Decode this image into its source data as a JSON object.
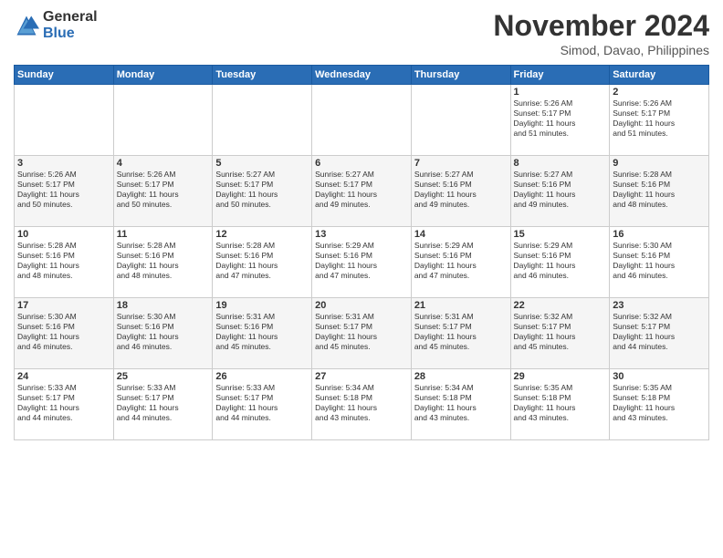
{
  "logo": {
    "general": "General",
    "blue": "Blue"
  },
  "title": "November 2024",
  "location": "Simod, Davao, Philippines",
  "weekdays": [
    "Sunday",
    "Monday",
    "Tuesday",
    "Wednesday",
    "Thursday",
    "Friday",
    "Saturday"
  ],
  "weeks": [
    [
      {
        "day": "",
        "info": ""
      },
      {
        "day": "",
        "info": ""
      },
      {
        "day": "",
        "info": ""
      },
      {
        "day": "",
        "info": ""
      },
      {
        "day": "",
        "info": ""
      },
      {
        "day": "1",
        "info": "Sunrise: 5:26 AM\nSunset: 5:17 PM\nDaylight: 11 hours\nand 51 minutes."
      },
      {
        "day": "2",
        "info": "Sunrise: 5:26 AM\nSunset: 5:17 PM\nDaylight: 11 hours\nand 51 minutes."
      }
    ],
    [
      {
        "day": "3",
        "info": "Sunrise: 5:26 AM\nSunset: 5:17 PM\nDaylight: 11 hours\nand 50 minutes."
      },
      {
        "day": "4",
        "info": "Sunrise: 5:26 AM\nSunset: 5:17 PM\nDaylight: 11 hours\nand 50 minutes."
      },
      {
        "day": "5",
        "info": "Sunrise: 5:27 AM\nSunset: 5:17 PM\nDaylight: 11 hours\nand 50 minutes."
      },
      {
        "day": "6",
        "info": "Sunrise: 5:27 AM\nSunset: 5:17 PM\nDaylight: 11 hours\nand 49 minutes."
      },
      {
        "day": "7",
        "info": "Sunrise: 5:27 AM\nSunset: 5:16 PM\nDaylight: 11 hours\nand 49 minutes."
      },
      {
        "day": "8",
        "info": "Sunrise: 5:27 AM\nSunset: 5:16 PM\nDaylight: 11 hours\nand 49 minutes."
      },
      {
        "day": "9",
        "info": "Sunrise: 5:28 AM\nSunset: 5:16 PM\nDaylight: 11 hours\nand 48 minutes."
      }
    ],
    [
      {
        "day": "10",
        "info": "Sunrise: 5:28 AM\nSunset: 5:16 PM\nDaylight: 11 hours\nand 48 minutes."
      },
      {
        "day": "11",
        "info": "Sunrise: 5:28 AM\nSunset: 5:16 PM\nDaylight: 11 hours\nand 48 minutes."
      },
      {
        "day": "12",
        "info": "Sunrise: 5:28 AM\nSunset: 5:16 PM\nDaylight: 11 hours\nand 47 minutes."
      },
      {
        "day": "13",
        "info": "Sunrise: 5:29 AM\nSunset: 5:16 PM\nDaylight: 11 hours\nand 47 minutes."
      },
      {
        "day": "14",
        "info": "Sunrise: 5:29 AM\nSunset: 5:16 PM\nDaylight: 11 hours\nand 47 minutes."
      },
      {
        "day": "15",
        "info": "Sunrise: 5:29 AM\nSunset: 5:16 PM\nDaylight: 11 hours\nand 46 minutes."
      },
      {
        "day": "16",
        "info": "Sunrise: 5:30 AM\nSunset: 5:16 PM\nDaylight: 11 hours\nand 46 minutes."
      }
    ],
    [
      {
        "day": "17",
        "info": "Sunrise: 5:30 AM\nSunset: 5:16 PM\nDaylight: 11 hours\nand 46 minutes."
      },
      {
        "day": "18",
        "info": "Sunrise: 5:30 AM\nSunset: 5:16 PM\nDaylight: 11 hours\nand 46 minutes."
      },
      {
        "day": "19",
        "info": "Sunrise: 5:31 AM\nSunset: 5:16 PM\nDaylight: 11 hours\nand 45 minutes."
      },
      {
        "day": "20",
        "info": "Sunrise: 5:31 AM\nSunset: 5:17 PM\nDaylight: 11 hours\nand 45 minutes."
      },
      {
        "day": "21",
        "info": "Sunrise: 5:31 AM\nSunset: 5:17 PM\nDaylight: 11 hours\nand 45 minutes."
      },
      {
        "day": "22",
        "info": "Sunrise: 5:32 AM\nSunset: 5:17 PM\nDaylight: 11 hours\nand 45 minutes."
      },
      {
        "day": "23",
        "info": "Sunrise: 5:32 AM\nSunset: 5:17 PM\nDaylight: 11 hours\nand 44 minutes."
      }
    ],
    [
      {
        "day": "24",
        "info": "Sunrise: 5:33 AM\nSunset: 5:17 PM\nDaylight: 11 hours\nand 44 minutes."
      },
      {
        "day": "25",
        "info": "Sunrise: 5:33 AM\nSunset: 5:17 PM\nDaylight: 11 hours\nand 44 minutes."
      },
      {
        "day": "26",
        "info": "Sunrise: 5:33 AM\nSunset: 5:17 PM\nDaylight: 11 hours\nand 44 minutes."
      },
      {
        "day": "27",
        "info": "Sunrise: 5:34 AM\nSunset: 5:18 PM\nDaylight: 11 hours\nand 43 minutes."
      },
      {
        "day": "28",
        "info": "Sunrise: 5:34 AM\nSunset: 5:18 PM\nDaylight: 11 hours\nand 43 minutes."
      },
      {
        "day": "29",
        "info": "Sunrise: 5:35 AM\nSunset: 5:18 PM\nDaylight: 11 hours\nand 43 minutes."
      },
      {
        "day": "30",
        "info": "Sunrise: 5:35 AM\nSunset: 5:18 PM\nDaylight: 11 hours\nand 43 minutes."
      }
    ]
  ]
}
